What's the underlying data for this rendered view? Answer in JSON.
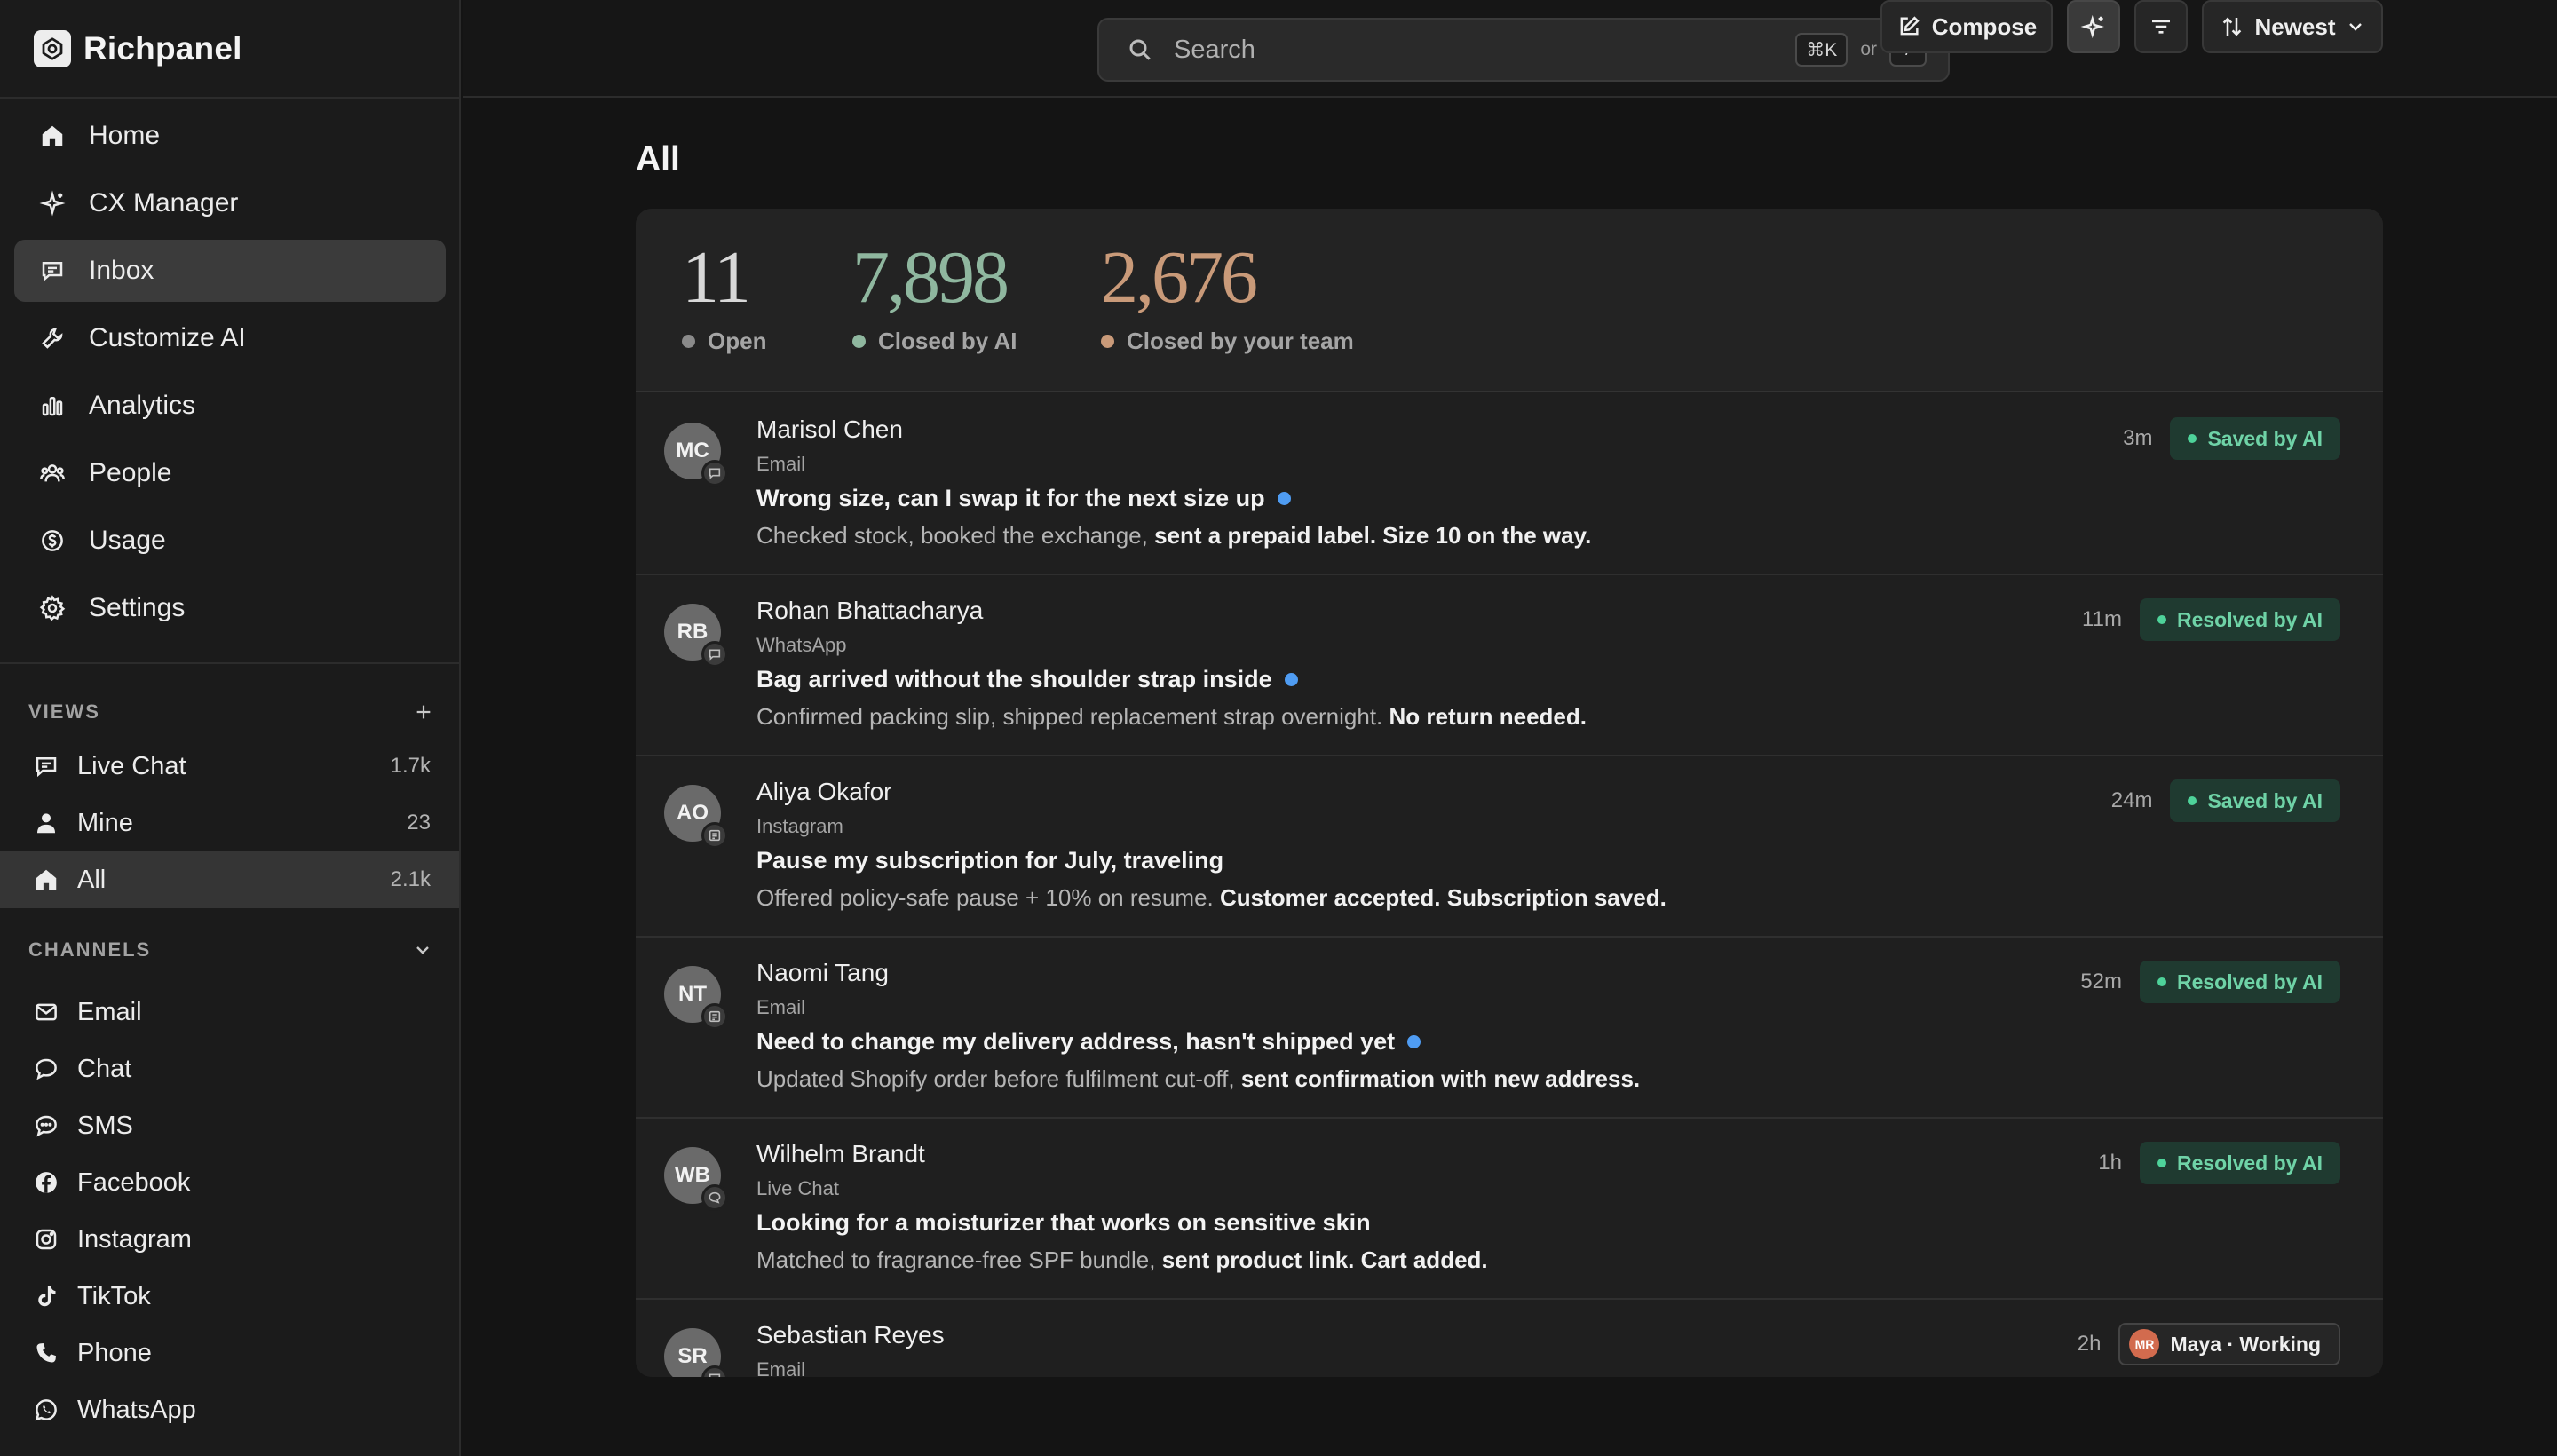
{
  "app": {
    "brand": "Richpanel"
  },
  "nav": {
    "items": [
      {
        "label": "Home",
        "icon": "home-icon"
      },
      {
        "label": "CX Manager",
        "icon": "sparkle-icon"
      },
      {
        "label": "Inbox",
        "icon": "chat-bubble-icon",
        "active": true
      },
      {
        "label": "Customize AI",
        "icon": "wrench-icon"
      },
      {
        "label": "Analytics",
        "icon": "bar-chart-icon"
      },
      {
        "label": "People",
        "icon": "people-icon"
      },
      {
        "label": "Usage",
        "icon": "dollar-circle-icon"
      },
      {
        "label": "Settings",
        "icon": "gear-icon"
      }
    ]
  },
  "views": {
    "heading": "VIEWS",
    "items": [
      {
        "label": "Live Chat",
        "count": "1.7k"
      },
      {
        "label": "Mine",
        "count": "23"
      },
      {
        "label": "All",
        "count": "2.1k",
        "active": true
      }
    ]
  },
  "channels": {
    "heading": "CHANNELS",
    "items": [
      {
        "label": "Email"
      },
      {
        "label": "Chat"
      },
      {
        "label": "SMS"
      },
      {
        "label": "Facebook"
      },
      {
        "label": "Instagram"
      },
      {
        "label": "TikTok"
      },
      {
        "label": "Phone"
      },
      {
        "label": "WhatsApp"
      }
    ]
  },
  "search": {
    "placeholder": "Search",
    "shortcut": "⌘K",
    "or": "or",
    "alt_shortcut": "/"
  },
  "main": {
    "title": "All",
    "compose_label": "Compose",
    "sort_label": "Newest"
  },
  "stats": [
    {
      "value": "11",
      "label": "Open",
      "color": "#8a8a8a"
    },
    {
      "value": "7,898",
      "label": "Closed by AI",
      "color": "#8fb79f"
    },
    {
      "value": "2,676",
      "label": "Closed by your team",
      "color": "#c99a79"
    }
  ],
  "conversations": [
    {
      "initials": "MC",
      "name": "Marisol Chen",
      "channel": "Email",
      "subject": "Wrong size, can I swap it for the next size up",
      "unread": true,
      "summary": "Checked stock, booked the exchange, ",
      "summary_bold": "sent a prepaid label. Size 10 on the way.",
      "time": "3m",
      "status": "Saved by AI"
    },
    {
      "initials": "RB",
      "name": "Rohan Bhattacharya",
      "channel": "WhatsApp",
      "subject": "Bag arrived without the shoulder strap inside",
      "unread": true,
      "summary": "Confirmed packing slip, shipped replacement strap overnight. ",
      "summary_bold": "No return needed.",
      "time": "11m",
      "status": "Resolved by AI"
    },
    {
      "initials": "AO",
      "name": "Aliya Okafor",
      "channel": "Instagram",
      "subject": "Pause my subscription for July, traveling",
      "unread": false,
      "summary": "Offered policy-safe pause + 10% on resume. ",
      "summary_bold": "Customer accepted. Subscription saved.",
      "time": "24m",
      "status": "Saved by AI"
    },
    {
      "initials": "NT",
      "name": "Naomi Tang",
      "channel": "Email",
      "subject": "Need to change my delivery address, hasn't shipped yet",
      "unread": true,
      "summary": "Updated Shopify order before fulfilment cut-off, ",
      "summary_bold": "sent confirmation with new address.",
      "time": "52m",
      "status": "Resolved by AI"
    },
    {
      "initials": "WB",
      "name": "Wilhelm Brandt",
      "channel": "Live Chat",
      "subject": "Looking for a moisturizer that works on sensitive skin",
      "unread": false,
      "summary": "Matched to fragrance-free SPF bundle, ",
      "summary_bold": "sent product link. Cart added.",
      "time": "1h",
      "status": "Resolved by AI"
    },
    {
      "initials": "SR",
      "name": "Sebastian Reyes",
      "channel": "Email",
      "time": "2h",
      "assignee_initials": "MR",
      "status": "Maya · Working"
    }
  ],
  "colors": {
    "accent_green": "#6fd3a7",
    "unread_blue": "#4f9cf2",
    "status_bg": "#1f3a30"
  }
}
